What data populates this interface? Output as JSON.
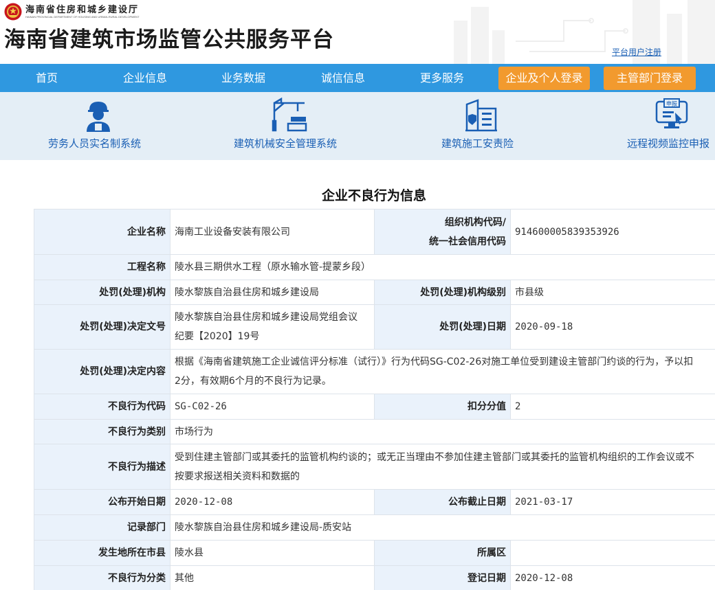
{
  "header": {
    "dept_name": "海南省住房和城乡建设厅",
    "dept_name_en": "HAINAN PROVINCIAL DEPARTMENT OF HOUSING AND URBAN-RURAL DEVELOPMENT",
    "site_title": "海南省建筑市场监管公共服务平台",
    "register_link": "平台用户注册"
  },
  "nav": {
    "items": [
      "首页",
      "企业信息",
      "业务数据",
      "诚信信息",
      "更多服务"
    ],
    "login_company": "企业及个人登录",
    "login_admin": "主管部门登录"
  },
  "services": [
    {
      "label": "劳务人员实名制系统",
      "icon": "worker-icon"
    },
    {
      "label": "建筑机械安全管理系统",
      "icon": "crane-icon"
    },
    {
      "label": "建筑施工安责险",
      "icon": "building-insurance-icon"
    },
    {
      "label": "远程视频监控申报",
      "icon": "monitor-report-icon"
    }
  ],
  "page": {
    "heading": "企业不良行为信息"
  },
  "record": {
    "company_name_label": "企业名称",
    "company_name": "海南工业设备安装有限公司",
    "org_code_label_1": "组织机构代码/",
    "org_code_label_2": "统一社会信用代码",
    "org_code": "91460000583935392​6",
    "project_label": "工程名称",
    "project": "陵水县三期供水工程（原水输水管-提蒙乡段）",
    "authority_label": "处罚(处理)机构",
    "authority": "陵水黎族自治县住房和城乡建设局",
    "authority_level_label": "处罚(处理)机构级别",
    "authority_level": "市县级",
    "decision_no_label": "处罚(处理)决定文号",
    "decision_no_1": "陵水黎族自治县住房和城乡建设局党组会议",
    "decision_no_2": "纪要【2020】19号",
    "decision_date_label": "处罚(处理)日期",
    "decision_date": "2020-09-18",
    "decision_content_label": "处罚(处理)决定内容",
    "decision_content_1": "根据《海南省建筑施工企业诚信评分标准（试行）》行为代码SG-C02-26对施工单位受到建设主管部门约谈的行为，予以扣",
    "decision_content_2": "2分，有效期6个月的不良行为记录。",
    "behavior_code_label": "不良行为代码",
    "behavior_code": "SG-C02-26",
    "deduct_label": "扣分分值",
    "deduct": "2",
    "behavior_type_label": "不良行为类别",
    "behavior_type": "市场行为",
    "behavior_desc_label": "不良行为描述",
    "behavior_desc_1": "受到住建主管部门或其委托的监管机构约谈的；或无正当理由不参加住建主管部门或其委托的监管机构组织的工作会议或不",
    "behavior_desc_2": "按要求报送相关资料和数据的",
    "publish_start_label": "公布开始日期",
    "publish_start": "2020-12-08",
    "publish_end_label": "公布截止日期",
    "publish_end": "2021-03-17",
    "record_dept_label": "记录部门",
    "record_dept": "陵水黎族自治县住房和城乡建设局-质安站",
    "city_label": "发生地所在市县",
    "city": "陵水县",
    "district_label": "所属区",
    "district": "",
    "category_label": "不良行为分类",
    "category": "其他",
    "register_date_label": "登记日期",
    "register_date": "2020-12-08"
  },
  "colors": {
    "nav_bg": "#2f98e0",
    "login_btn": "#f29a2e",
    "service_bg": "#e4eef6",
    "label_bg": "#eaf2fb",
    "link": "#1a5fb4"
  }
}
